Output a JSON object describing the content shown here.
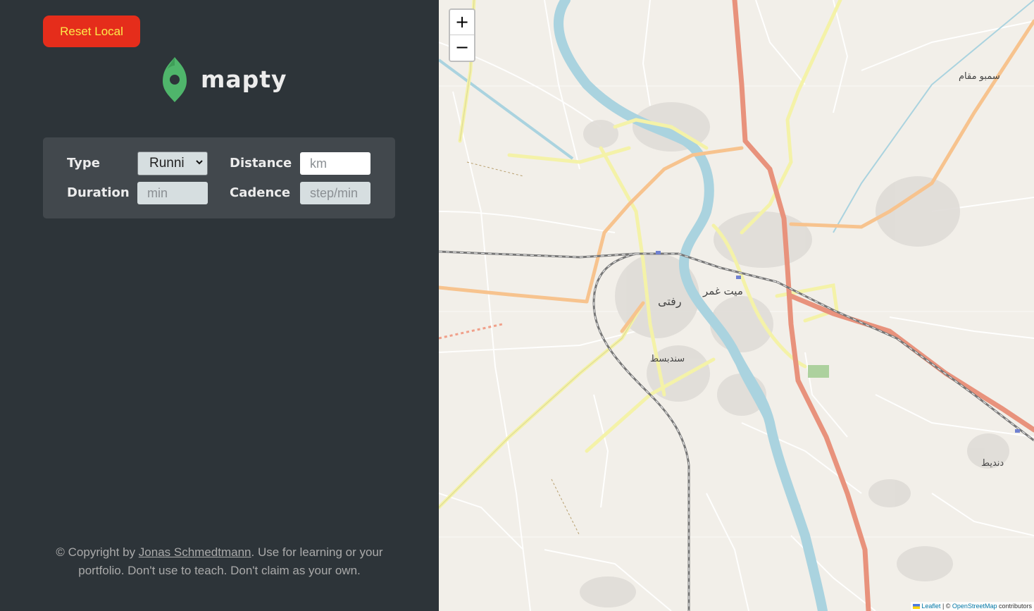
{
  "sidebar": {
    "reset_label": "Reset Local",
    "logo_text": "mapty",
    "form": {
      "type_label": "Type",
      "type_value": "Runni",
      "distance_label": "Distance",
      "distance_placeholder": "km",
      "duration_label": "Duration",
      "duration_placeholder": "min",
      "cadence_label": "Cadence",
      "cadence_placeholder": "step/min"
    },
    "copyright": {
      "prefix": "© Copyright by ",
      "author": "Jonas Schmedtmann",
      "suffix": ". Use for learning or your portfolio. Don't use to teach. Don't claim as your own."
    }
  },
  "map": {
    "zoom_in": "+",
    "zoom_out": "−",
    "attribution": {
      "leaflet": "Leaflet",
      "separator": " | © ",
      "osm": "OpenStreetMap",
      "suffix": " contributors"
    },
    "labels": {
      "zefta": "رفتى",
      "mit_ghamr": "ميت غمر",
      "sondosbat": "سندبسط",
      "sembo_maqam": "سمبو مقام",
      "dandeet": "دنديط"
    }
  },
  "colors": {
    "sidebar_bg": "#2d3439",
    "form_bg": "#42484d",
    "reset_bg": "#e52d1b",
    "reset_text": "#fdeb4a",
    "brand_green": "#4fb56b",
    "map_bg": "#f2efe9",
    "river": "#aad3df",
    "primary_road": "#e8927c",
    "secondary_road": "#f7c38e",
    "tertiary_road": "#f4f2a8"
  }
}
